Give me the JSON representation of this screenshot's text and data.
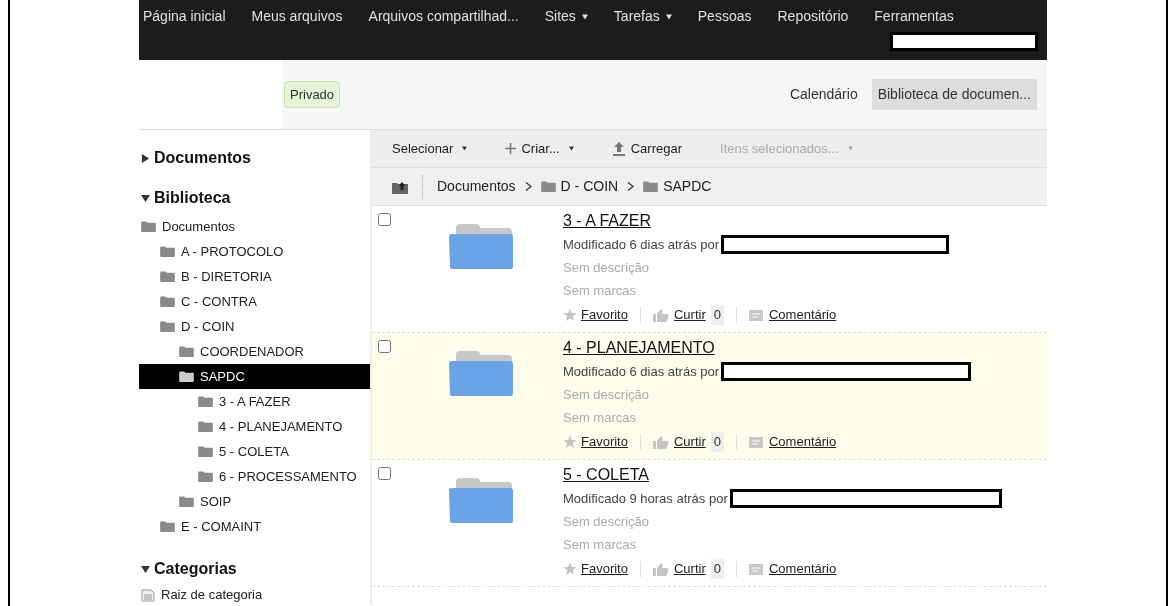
{
  "nav": {
    "items": [
      {
        "label": "Página inicial",
        "menu": false
      },
      {
        "label": "Meus arquivos",
        "menu": false
      },
      {
        "label": "Arquivos compartilhad...",
        "menu": false
      },
      {
        "label": "Sites",
        "menu": true
      },
      {
        "label": "Tarefas",
        "menu": true
      },
      {
        "label": "Pessoas",
        "menu": false
      },
      {
        "label": "Repositório",
        "menu": false
      },
      {
        "label": "Ferramentas",
        "menu": false
      }
    ]
  },
  "header": {
    "badge": "Privado",
    "links": [
      {
        "label": "Calendário",
        "selected": false
      },
      {
        "label": "Biblioteca de documen...",
        "selected": true
      }
    ]
  },
  "sidebar": {
    "sections": [
      {
        "title": "Documentos",
        "expanded": false
      },
      {
        "title": "Biblioteca",
        "expanded": true,
        "tree": [
          {
            "label": "Documentos",
            "selected": false,
            "children": [
              {
                "label": "A - PROTOCOLO",
                "selected": false
              },
              {
                "label": "B - DIRETORIA",
                "selected": false
              },
              {
                "label": "C - CONTRA",
                "selected": false
              },
              {
                "label": "D - COIN",
                "selected": false,
                "children": [
                  {
                    "label": "COORDENADOR",
                    "selected": false
                  },
                  {
                    "label": "SAPDC",
                    "selected": true,
                    "children": [
                      {
                        "label": "3 - A FAZER",
                        "selected": false
                      },
                      {
                        "label": "4 - PLANEJAMENTO",
                        "selected": false
                      },
                      {
                        "label": "5 - COLETA",
                        "selected": false
                      },
                      {
                        "label": "6 - PROCESSAMENTO",
                        "selected": false
                      }
                    ]
                  },
                  {
                    "label": "SOIP",
                    "selected": false
                  }
                ]
              },
              {
                "label": "E - COMAINT",
                "selected": false
              }
            ]
          }
        ]
      },
      {
        "title": "Categorias",
        "expanded": true,
        "category": "Raiz de categoria"
      }
    ]
  },
  "toolbar": {
    "buttons": [
      {
        "label": "Selecionar",
        "kind": "menu",
        "disabled": false
      },
      {
        "label": "Criar...",
        "kind": "create",
        "disabled": false
      },
      {
        "label": "Carregar",
        "kind": "upload",
        "disabled": false
      },
      {
        "label": "Itens selecionados...",
        "kind": "menu",
        "disabled": true
      }
    ]
  },
  "breadcrumb": [
    {
      "label": "Documentos",
      "folder": false
    },
    {
      "label": "D - COIN",
      "folder": true
    },
    {
      "label": "SAPDC",
      "folder": true
    }
  ],
  "rows": [
    {
      "title": "3 - A FAZER",
      "modified": "Modificado 6 dias atrás por",
      "description": "Sem descrição",
      "tags": "Sem marcas",
      "favorite": "Favorito",
      "like": "Curtir",
      "likes": "0",
      "comment": "Comentário",
      "checked": false,
      "highlighted": false
    },
    {
      "title": "4 - PLANEJAMENTO",
      "modified": "Modificado 6 dias atrás por",
      "description": "Sem descrição",
      "tags": "Sem marcas",
      "favorite": "Favorito",
      "like": "Curtir",
      "likes": "0",
      "comment": "Comentário",
      "checked": false,
      "highlighted": true
    },
    {
      "title": "5 - COLETA",
      "modified": "Modificado 9 horas atrás por",
      "description": "Sem descrição",
      "tags": "Sem marcas",
      "favorite": "Favorito",
      "like": "Curtir",
      "likes": "0",
      "comment": "Comentário",
      "checked": false,
      "highlighted": false
    }
  ]
}
